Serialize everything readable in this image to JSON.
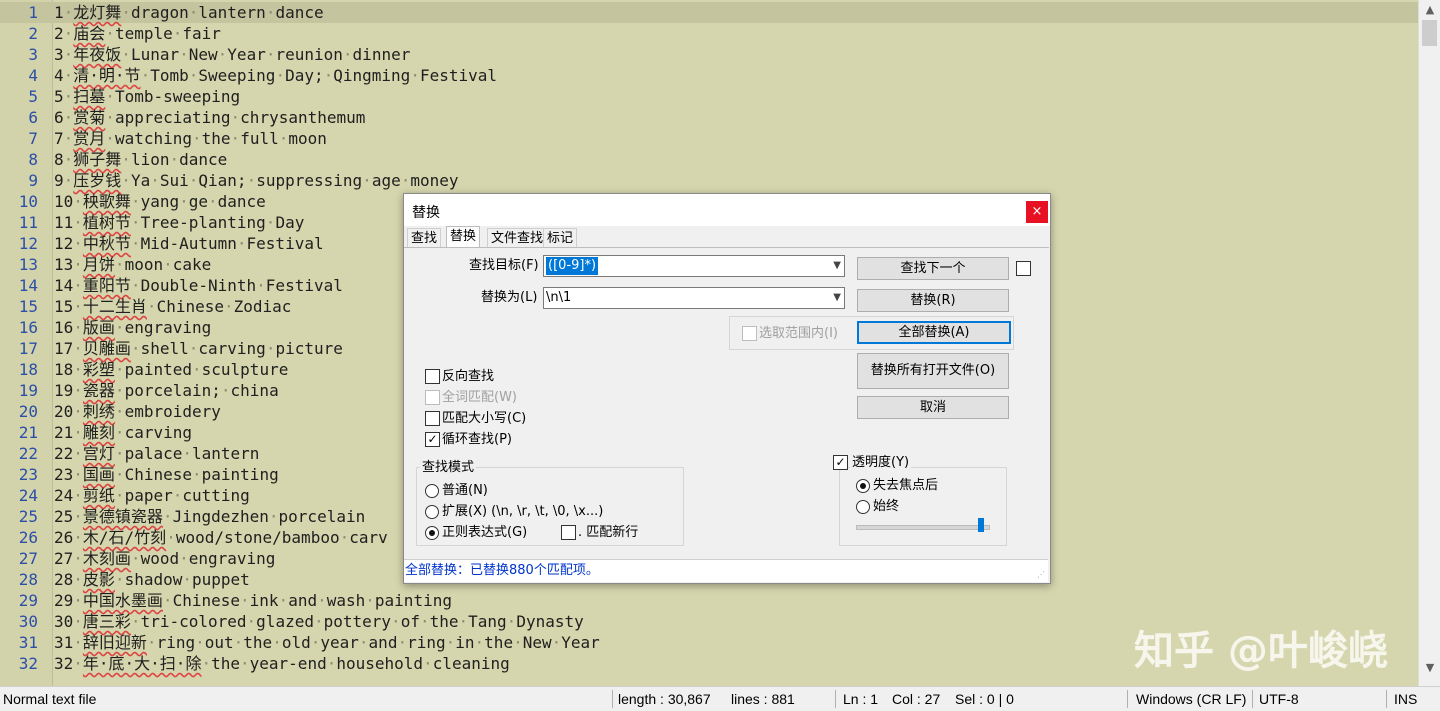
{
  "editor": {
    "lines": [
      {
        "n": "1",
        "zh": "龙灯舞",
        "en": "dragon lantern dance"
      },
      {
        "n": "2",
        "zh": "庙会",
        "en": "temple fair"
      },
      {
        "n": "3",
        "zh": "年夜饭",
        "en": "Lunar New Year reunion dinner"
      },
      {
        "n": "4",
        "zh": "清·明·节",
        "en": "Tomb Sweeping Day; Qingming Festival"
      },
      {
        "n": "5",
        "zh": "扫墓",
        "en": "Tomb-sweeping"
      },
      {
        "n": "6",
        "zh": "赏菊",
        "en": "appreciating chrysanthemum"
      },
      {
        "n": "7",
        "zh": "赏月",
        "en": "watching the full moon"
      },
      {
        "n": "8",
        "zh": "狮子舞",
        "en": "lion dance"
      },
      {
        "n": "9",
        "zh": "压岁钱",
        "en": "Ya Sui Qian; suppressing age money"
      },
      {
        "n": "10",
        "zh": "秧歌舞",
        "en": "yang ge dance"
      },
      {
        "n": "11",
        "zh": "植树节",
        "en": "Tree-planting Day"
      },
      {
        "n": "12",
        "zh": "中秋节",
        "en": "Mid-Autumn Festival"
      },
      {
        "n": "13",
        "zh": "月饼",
        "en": "moon cake"
      },
      {
        "n": "14",
        "zh": "重阳节",
        "en": "Double-Ninth Festival"
      },
      {
        "n": "15",
        "zh": "十二生肖",
        "en": "Chinese Zodiac"
      },
      {
        "n": "16",
        "zh": "版画",
        "en": "engraving"
      },
      {
        "n": "17",
        "zh": "贝雕画",
        "en": "shell carving picture"
      },
      {
        "n": "18",
        "zh": "彩塑",
        "en": "painted sculpture"
      },
      {
        "n": "19",
        "zh": "瓷器",
        "en": "porcelain; china"
      },
      {
        "n": "20",
        "zh": "刺绣",
        "en": "embroidery"
      },
      {
        "n": "21",
        "zh": "雕刻",
        "en": "carving"
      },
      {
        "n": "22",
        "zh": "宫灯",
        "en": "palace lantern"
      },
      {
        "n": "23",
        "zh": "国画",
        "en": "Chinese painting"
      },
      {
        "n": "24",
        "zh": "剪纸",
        "en": "paper cutting"
      },
      {
        "n": "25",
        "zh": "景德镇瓷器",
        "en": "Jingdezhen porcelain"
      },
      {
        "n": "26",
        "zh": "木/石/竹刻",
        "en": "wood/stone/bamboo carv"
      },
      {
        "n": "27",
        "zh": "木刻画",
        "en": "wood engraving"
      },
      {
        "n": "28",
        "zh": "皮影",
        "en": "shadow puppet"
      },
      {
        "n": "29",
        "zh": "中国水墨画",
        "en": "Chinese ink and wash painting"
      },
      {
        "n": "30",
        "zh": "唐三彩",
        "en": "tri-colored glazed pottery of the Tang Dynasty"
      },
      {
        "n": "31",
        "zh": "辞旧迎新",
        "en": "ring out the old year and ring in the New Year"
      },
      {
        "n": "32",
        "zh": "年·底·大·扫·除",
        "en": "the year-end household cleaning"
      }
    ]
  },
  "status": {
    "type": "Normal text file",
    "length": "length : 30,867",
    "lines": "lines : 881",
    "ln": "Ln : 1",
    "col": "Col : 27",
    "sel": "Sel : 0 | 0",
    "eol": "Windows (CR LF)",
    "encoding": "UTF-8",
    "mode": "INS"
  },
  "watermark": "知乎 @叶峻峣",
  "dialog": {
    "title": "替换",
    "close": "×",
    "tabs": [
      "查找",
      "替换",
      "文件查找",
      "标记"
    ],
    "find_label": "查找目标(F) :",
    "find_value": "([0-9]*)",
    "replace_label": "替换为(L) :",
    "replace_value": "\\n\\1",
    "in_selection": "选取范围内(I)",
    "buttons": {
      "find_next": "查找下一个",
      "replace": "替换(R)",
      "replace_all": "全部替换(A)",
      "replace_all_open": "替换所有打开文件(O)",
      "cancel": "取消"
    },
    "options": {
      "backward": "反向查找",
      "whole_word": "全词匹配(W)",
      "match_case": "匹配大小写(C)",
      "wrap": "循环查找(P)"
    },
    "search_mode": {
      "title": "查找模式",
      "normal": "普通(N)",
      "extended": "扩展(X) (\\n, \\r, \\t, \\0, \\x...)",
      "regex": "正则表达式(G)",
      "dot_newline": ". 匹配新行"
    },
    "transparency": {
      "title": "透明度(Y)",
      "on_lose_focus": "失去焦点后",
      "always": "始终",
      "level": 0.95
    },
    "result": "全部替换：已替换880个匹配项。"
  }
}
